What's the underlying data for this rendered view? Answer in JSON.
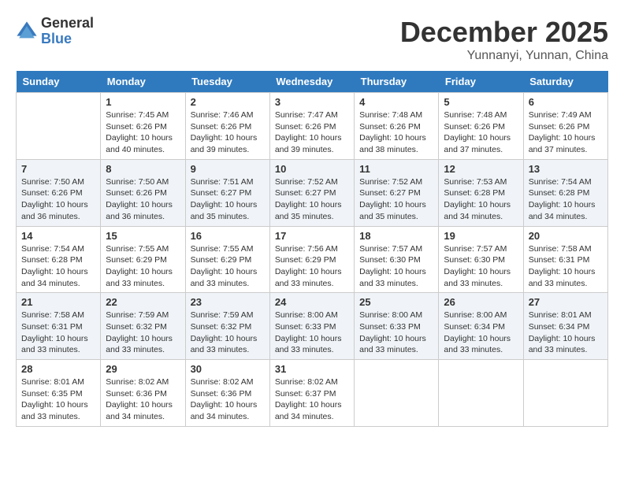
{
  "header": {
    "logo_general": "General",
    "logo_blue": "Blue",
    "month": "December 2025",
    "location": "Yunnanyi, Yunnan, China"
  },
  "weekdays": [
    "Sunday",
    "Monday",
    "Tuesday",
    "Wednesday",
    "Thursday",
    "Friday",
    "Saturday"
  ],
  "weeks": [
    [
      {
        "day": "",
        "sunrise": "",
        "sunset": "",
        "daylight": ""
      },
      {
        "day": "1",
        "sunrise": "Sunrise: 7:45 AM",
        "sunset": "Sunset: 6:26 PM",
        "daylight": "Daylight: 10 hours and 40 minutes."
      },
      {
        "day": "2",
        "sunrise": "Sunrise: 7:46 AM",
        "sunset": "Sunset: 6:26 PM",
        "daylight": "Daylight: 10 hours and 39 minutes."
      },
      {
        "day": "3",
        "sunrise": "Sunrise: 7:47 AM",
        "sunset": "Sunset: 6:26 PM",
        "daylight": "Daylight: 10 hours and 39 minutes."
      },
      {
        "day": "4",
        "sunrise": "Sunrise: 7:48 AM",
        "sunset": "Sunset: 6:26 PM",
        "daylight": "Daylight: 10 hours and 38 minutes."
      },
      {
        "day": "5",
        "sunrise": "Sunrise: 7:48 AM",
        "sunset": "Sunset: 6:26 PM",
        "daylight": "Daylight: 10 hours and 37 minutes."
      },
      {
        "day": "6",
        "sunrise": "Sunrise: 7:49 AM",
        "sunset": "Sunset: 6:26 PM",
        "daylight": "Daylight: 10 hours and 37 minutes."
      }
    ],
    [
      {
        "day": "7",
        "sunrise": "Sunrise: 7:50 AM",
        "sunset": "Sunset: 6:26 PM",
        "daylight": "Daylight: 10 hours and 36 minutes."
      },
      {
        "day": "8",
        "sunrise": "Sunrise: 7:50 AM",
        "sunset": "Sunset: 6:26 PM",
        "daylight": "Daylight: 10 hours and 36 minutes."
      },
      {
        "day": "9",
        "sunrise": "Sunrise: 7:51 AM",
        "sunset": "Sunset: 6:27 PM",
        "daylight": "Daylight: 10 hours and 35 minutes."
      },
      {
        "day": "10",
        "sunrise": "Sunrise: 7:52 AM",
        "sunset": "Sunset: 6:27 PM",
        "daylight": "Daylight: 10 hours and 35 minutes."
      },
      {
        "day": "11",
        "sunrise": "Sunrise: 7:52 AM",
        "sunset": "Sunset: 6:27 PM",
        "daylight": "Daylight: 10 hours and 35 minutes."
      },
      {
        "day": "12",
        "sunrise": "Sunrise: 7:53 AM",
        "sunset": "Sunset: 6:28 PM",
        "daylight": "Daylight: 10 hours and 34 minutes."
      },
      {
        "day": "13",
        "sunrise": "Sunrise: 7:54 AM",
        "sunset": "Sunset: 6:28 PM",
        "daylight": "Daylight: 10 hours and 34 minutes."
      }
    ],
    [
      {
        "day": "14",
        "sunrise": "Sunrise: 7:54 AM",
        "sunset": "Sunset: 6:28 PM",
        "daylight": "Daylight: 10 hours and 34 minutes."
      },
      {
        "day": "15",
        "sunrise": "Sunrise: 7:55 AM",
        "sunset": "Sunset: 6:29 PM",
        "daylight": "Daylight: 10 hours and 33 minutes."
      },
      {
        "day": "16",
        "sunrise": "Sunrise: 7:55 AM",
        "sunset": "Sunset: 6:29 PM",
        "daylight": "Daylight: 10 hours and 33 minutes."
      },
      {
        "day": "17",
        "sunrise": "Sunrise: 7:56 AM",
        "sunset": "Sunset: 6:29 PM",
        "daylight": "Daylight: 10 hours and 33 minutes."
      },
      {
        "day": "18",
        "sunrise": "Sunrise: 7:57 AM",
        "sunset": "Sunset: 6:30 PM",
        "daylight": "Daylight: 10 hours and 33 minutes."
      },
      {
        "day": "19",
        "sunrise": "Sunrise: 7:57 AM",
        "sunset": "Sunset: 6:30 PM",
        "daylight": "Daylight: 10 hours and 33 minutes."
      },
      {
        "day": "20",
        "sunrise": "Sunrise: 7:58 AM",
        "sunset": "Sunset: 6:31 PM",
        "daylight": "Daylight: 10 hours and 33 minutes."
      }
    ],
    [
      {
        "day": "21",
        "sunrise": "Sunrise: 7:58 AM",
        "sunset": "Sunset: 6:31 PM",
        "daylight": "Daylight: 10 hours and 33 minutes."
      },
      {
        "day": "22",
        "sunrise": "Sunrise: 7:59 AM",
        "sunset": "Sunset: 6:32 PM",
        "daylight": "Daylight: 10 hours and 33 minutes."
      },
      {
        "day": "23",
        "sunrise": "Sunrise: 7:59 AM",
        "sunset": "Sunset: 6:32 PM",
        "daylight": "Daylight: 10 hours and 33 minutes."
      },
      {
        "day": "24",
        "sunrise": "Sunrise: 8:00 AM",
        "sunset": "Sunset: 6:33 PM",
        "daylight": "Daylight: 10 hours and 33 minutes."
      },
      {
        "day": "25",
        "sunrise": "Sunrise: 8:00 AM",
        "sunset": "Sunset: 6:33 PM",
        "daylight": "Daylight: 10 hours and 33 minutes."
      },
      {
        "day": "26",
        "sunrise": "Sunrise: 8:00 AM",
        "sunset": "Sunset: 6:34 PM",
        "daylight": "Daylight: 10 hours and 33 minutes."
      },
      {
        "day": "27",
        "sunrise": "Sunrise: 8:01 AM",
        "sunset": "Sunset: 6:34 PM",
        "daylight": "Daylight: 10 hours and 33 minutes."
      }
    ],
    [
      {
        "day": "28",
        "sunrise": "Sunrise: 8:01 AM",
        "sunset": "Sunset: 6:35 PM",
        "daylight": "Daylight: 10 hours and 33 minutes."
      },
      {
        "day": "29",
        "sunrise": "Sunrise: 8:02 AM",
        "sunset": "Sunset: 6:36 PM",
        "daylight": "Daylight: 10 hours and 34 minutes."
      },
      {
        "day": "30",
        "sunrise": "Sunrise: 8:02 AM",
        "sunset": "Sunset: 6:36 PM",
        "daylight": "Daylight: 10 hours and 34 minutes."
      },
      {
        "day": "31",
        "sunrise": "Sunrise: 8:02 AM",
        "sunset": "Sunset: 6:37 PM",
        "daylight": "Daylight: 10 hours and 34 minutes."
      },
      {
        "day": "",
        "sunrise": "",
        "sunset": "",
        "daylight": ""
      },
      {
        "day": "",
        "sunrise": "",
        "sunset": "",
        "daylight": ""
      },
      {
        "day": "",
        "sunrise": "",
        "sunset": "",
        "daylight": ""
      }
    ]
  ]
}
